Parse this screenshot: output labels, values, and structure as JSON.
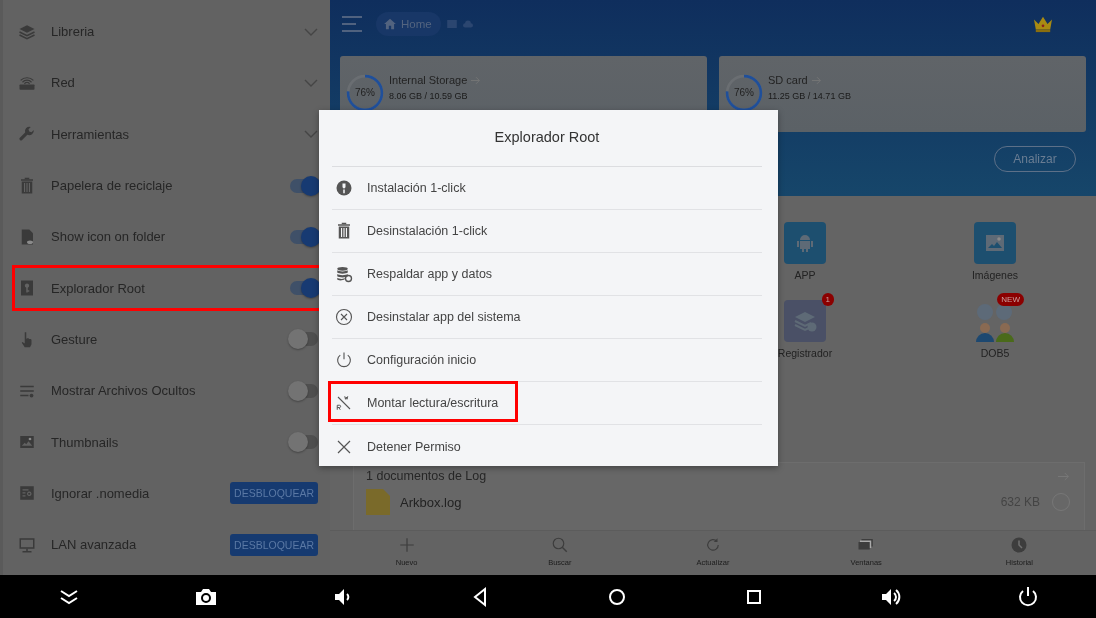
{
  "sidebar": {
    "items": [
      {
        "kind": "expand",
        "label": "Libreria",
        "highlighted": false
      },
      {
        "kind": "expand",
        "label": "Red",
        "highlighted": false
      },
      {
        "kind": "expand",
        "label": "Herramientas",
        "highlighted": false
      },
      {
        "kind": "toggle",
        "label": "Papelera de reciclaje",
        "on": true,
        "highlighted": false
      },
      {
        "kind": "toggle",
        "label": "Show icon on folder",
        "on": true,
        "highlighted": false
      },
      {
        "kind": "toggle",
        "label": "Explorador Root",
        "on": true,
        "highlighted": true
      },
      {
        "kind": "toggle",
        "label": "Gesture",
        "on": false,
        "highlighted": false
      },
      {
        "kind": "toggle",
        "label": "Mostrar Archivos Ocultos",
        "on": false,
        "highlighted": false
      },
      {
        "kind": "toggle",
        "label": "Thumbnails",
        "on": false,
        "highlighted": false
      },
      {
        "kind": "button",
        "label": "Ignorar .nomedia",
        "button": "DESBLOQUEAR",
        "highlighted": false
      },
      {
        "kind": "button",
        "label": "LAN avanzada",
        "button": "DESBLOQUEAR",
        "highlighted": false
      }
    ]
  },
  "header": {
    "breadcrumb": "Home"
  },
  "storage": [
    {
      "name": "Internal Storage",
      "percent": "76%",
      "usage": "8.06 GB / 10.59 GB"
    },
    {
      "name": "SD card",
      "percent": "76%",
      "usage": "11.25 GB / 14.71 GB"
    }
  ],
  "analyze_button": "Analizar",
  "shortcuts": [
    {
      "label": "APP"
    },
    {
      "label": "Imágenes"
    },
    {
      "label": "Registrador",
      "badge": "1"
    },
    {
      "label": "DOB5",
      "badge": "NEW"
    }
  ],
  "log_card": {
    "title": "1 documentos de Log",
    "file": {
      "name": "Arkbox.log",
      "size": "632 KB",
      "selected": false
    }
  },
  "toolbar": [
    {
      "label": "Nuevo"
    },
    {
      "label": "Buscar"
    },
    {
      "label": "Actualizar"
    },
    {
      "label": "Ventanas"
    },
    {
      "label": "Historial"
    }
  ],
  "dialog": {
    "title": "Explorador Root",
    "items": [
      {
        "label": "Instalación 1-click",
        "highlighted": false
      },
      {
        "label": "Desinstalación 1-click",
        "highlighted": false
      },
      {
        "label": "Respaldar app y datos",
        "highlighted": false
      },
      {
        "label": "Desinstalar app del sistema",
        "highlighted": false
      },
      {
        "label": "Configuración inicio",
        "highlighted": false
      },
      {
        "label": "Montar lectura/escritura",
        "highlighted": true
      },
      {
        "label": "Detener Permiso",
        "highlighted": false
      }
    ]
  }
}
